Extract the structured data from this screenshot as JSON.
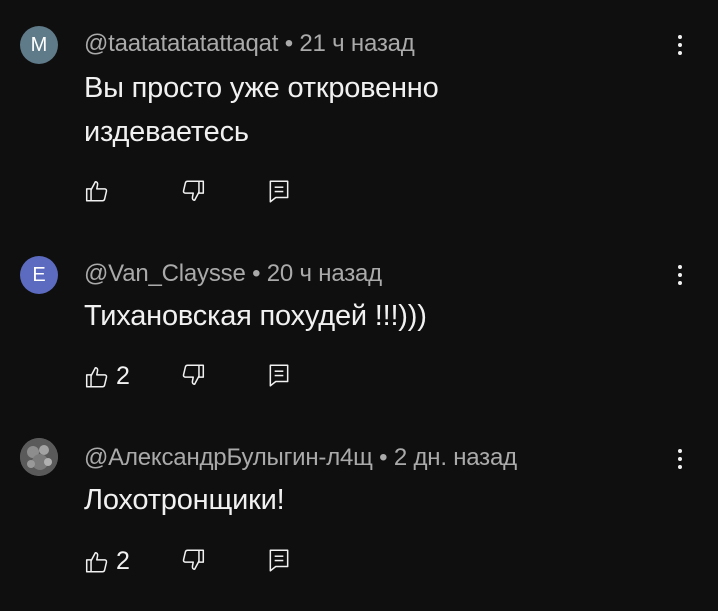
{
  "comments": [
    {
      "avatar_letter": "M",
      "avatar_color": "#5f7a88",
      "author": "@taatatatatattaqat",
      "separator": "•",
      "time": "21 ч назад",
      "text_lines": [
        "Вы просто уже откровенно",
        "издеваетесь"
      ],
      "likes": ""
    },
    {
      "avatar_letter": "E",
      "avatar_color": "#5c6bc0",
      "author": "@Van_Claysse",
      "separator": "•",
      "time": "20 ч назад",
      "text_lines": [
        "Тихановская похудей !!!)))"
      ],
      "likes": "2"
    },
    {
      "avatar_letter": "",
      "avatar_color": "#7a7a7a",
      "author": "@АлександрБулыгин-л4щ",
      "separator": "•",
      "time": "2 дн. назад",
      "text_lines": [
        "Лохотронщики!"
      ],
      "likes": "2"
    }
  ],
  "icons": {
    "like": "thumb-up-icon",
    "dislike": "thumb-down-icon",
    "reply": "reply-comment-icon",
    "menu": "more-vertical-icon"
  }
}
